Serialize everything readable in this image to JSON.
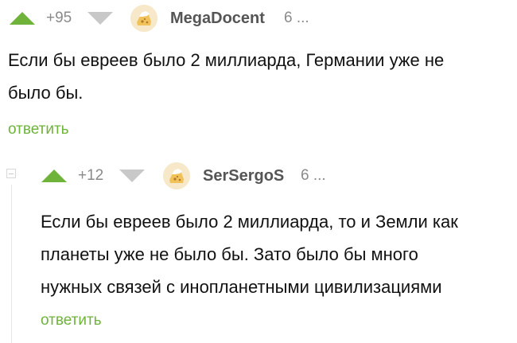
{
  "comments": [
    {
      "rating": "+95",
      "username": "MegaDocent",
      "time": "6 ...",
      "text_lines": [
        "Если бы евреев было 2 миллиарда, Германии уже не",
        "было бы."
      ],
      "reply_label": "ответить"
    },
    {
      "rating": "+12",
      "username": "SerSergoS",
      "time": "6 ...",
      "text_lines": [
        "Если бы евреев было 2 миллиарда, то и Земли как",
        "планеты уже не было бы. Зато было бы много",
        "нужных связей с инопланетными цивилизациями"
      ],
      "reply_label": "ответить"
    }
  ],
  "colors": {
    "accent_green": "#6fb33a",
    "downvote_gray": "#c8c8c8",
    "meta_gray": "#8a8a8a"
  },
  "icons": [
    "upvote-arrow-icon",
    "downvote-arrow-icon",
    "avatar-icon",
    "collapse-icon"
  ]
}
